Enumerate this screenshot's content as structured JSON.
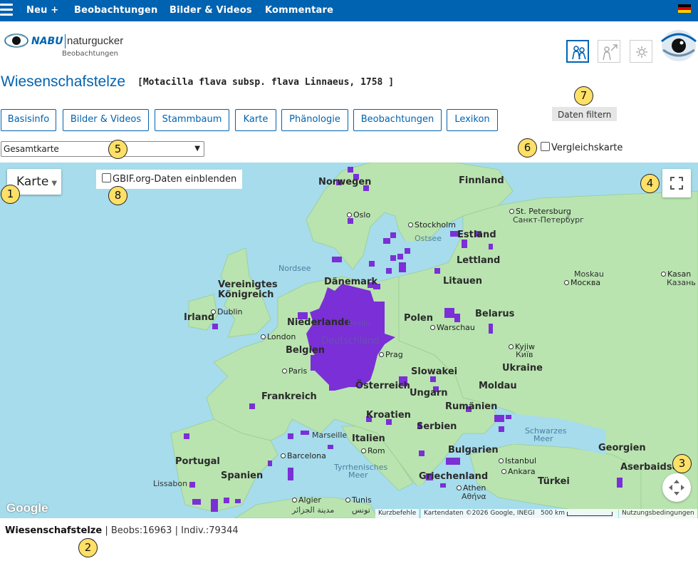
{
  "nav": {
    "items": [
      "Neu +",
      "Beobachtungen",
      "Bilder & Videos",
      "Kommentare"
    ],
    "flag_colors": [
      "#000000",
      "#dd0000",
      "#ffce00"
    ]
  },
  "logo": {
    "brand": "NABU",
    "name": "naturgucker",
    "sub": "Beobachtungen"
  },
  "header_icons": [
    "people-icon",
    "person-arrow-icon",
    "gear-icon"
  ],
  "species": {
    "name": "Wiesenschafstelze",
    "scientific": "[Motacilla flava subsp. flava Linnaeus, 1758 ]"
  },
  "filter_label": "Daten filtern",
  "tabs": [
    "Basisinfo",
    "Bilder & Videos",
    "Stammbaum",
    "Karte",
    "Phänologie",
    "Beobachtungen",
    "Lexikon"
  ],
  "map_select": {
    "selected": "Gesamtkarte"
  },
  "compare_label": "Vergleichskarte",
  "map": {
    "type_label": "Karte",
    "gbif_label": "GBIF.org-Daten einblenden",
    "occurrence_color": "#7b2fd6",
    "labels": {
      "countries": [
        "Norwegen",
        "Finnland",
        "Estland",
        "Lettland",
        "Litauen",
        "Dänemark",
        "Vereinigtes",
        "Königreich",
        "Irland",
        "Niederlande",
        "Belgien",
        "Polen",
        "Belarus",
        "Ukraine",
        "Deutschland",
        "Frankreich",
        "Slowakei",
        "Österreich",
        "Ungarn",
        "Moldau",
        "Rumänien",
        "Kroatien",
        "Serbien",
        "Bulgarien",
        "Italien",
        "Portugal",
        "Spanien",
        "Griechenland",
        "Türkei",
        "Georgien",
        "Aserbaidsch"
      ],
      "seas": [
        "Nordsee",
        "Ostsee",
        "Schwarzes",
        "Meer",
        "Tyrrhenisches",
        "Meer"
      ],
      "cities": [
        "Oslo",
        "Stockholm",
        "St. Petersburg",
        "Санкт-Петербург",
        "Moskau",
        "Москва",
        "Kasan",
        "Казань",
        "Dublin",
        "London",
        "Paris",
        "Berlin",
        "Prag",
        "Warschau",
        "Kyjiw",
        "Київ",
        "Marseille",
        "Barcelona",
        "Rom",
        "Istanbul",
        "Ankara",
        "Athen",
        "Αθήνα",
        "Lissabon",
        "Algier",
        "مدينة الجزائر",
        "Tunis",
        "تونس"
      ]
    },
    "attribution": {
      "shortcuts": "Kurzbefehle",
      "data": "Kartendaten ©2026 Google, INEGI",
      "scale": "500 km",
      "terms": "Nutzungsbedingungen"
    },
    "google": "Google"
  },
  "footer": {
    "name": "Wiesenschafstelze",
    "beobs": "| Beobs:16963",
    "indiv": "| Indiv.:79344"
  },
  "callouts": [
    "1",
    "2",
    "3",
    "4",
    "5",
    "6",
    "7",
    "8"
  ]
}
